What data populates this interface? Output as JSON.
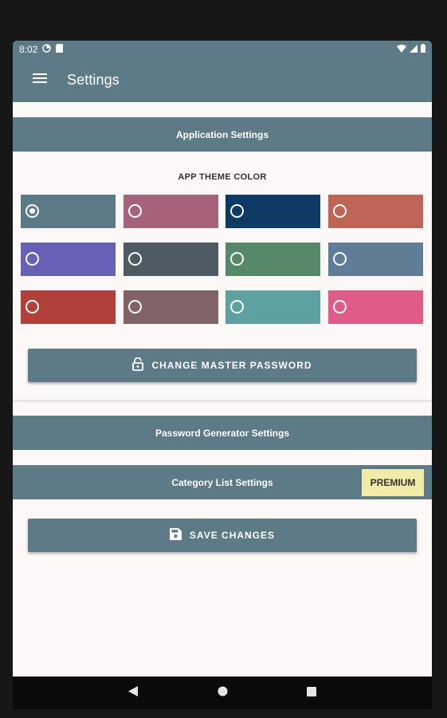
{
  "status_bar": {
    "time": "8:02"
  },
  "app_bar": {
    "title": "Settings"
  },
  "sections": {
    "application": "Application Settings",
    "password_generator": "Password Generator Settings",
    "category_list": "Category List Settings"
  },
  "theme": {
    "label": "APP THEME COLOR",
    "selected_index": 0,
    "colors": [
      "#5b7a85",
      "#a6627b",
      "#0e3a66",
      "#bf6556",
      "#6461b6",
      "#4e5a64",
      "#568969",
      "#5f7d96",
      "#b1403b",
      "#816266",
      "#5da2a0",
      "#e05b88"
    ]
  },
  "buttons": {
    "change_master_password": "CHANGE MASTER PASSWORD",
    "save_changes": "SAVE CHANGES"
  },
  "premium_badge": "PREMIUM",
  "colors": {
    "accent": "#5d7b86",
    "background": "#fcf8f7",
    "premium": "#f0eba6"
  },
  "icons": {
    "menu": "hamburger-icon",
    "lock": "lock-icon",
    "save": "floppy-disk-icon",
    "back": "back-triangle-icon",
    "home": "home-circle-icon",
    "recents": "recents-square-icon"
  }
}
